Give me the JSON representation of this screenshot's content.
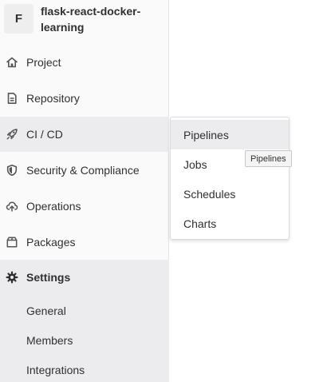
{
  "project": {
    "avatar_letter": "F",
    "name": "flask-react-docker-learning"
  },
  "sidebar": {
    "items": [
      {
        "label": "Project",
        "icon": "home-icon"
      },
      {
        "label": "Repository",
        "icon": "document-icon"
      },
      {
        "label": "CI / CD",
        "icon": "rocket-icon"
      },
      {
        "label": "Security & Compliance",
        "icon": "shield-icon"
      },
      {
        "label": "Operations",
        "icon": "cloud-upload-icon"
      },
      {
        "label": "Packages",
        "icon": "package-icon"
      },
      {
        "label": "Settings",
        "icon": "gear-icon"
      }
    ],
    "settings_subitems": [
      {
        "label": "General"
      },
      {
        "label": "Members"
      },
      {
        "label": "Integrations"
      }
    ]
  },
  "flyout": {
    "items": [
      {
        "label": "Pipelines"
      },
      {
        "label": "Jobs"
      },
      {
        "label": "Schedules"
      },
      {
        "label": "Charts"
      }
    ]
  },
  "tooltip": {
    "text": "Pipelines"
  },
  "colors": {
    "sidebar_bg": "#fafafa",
    "active_bg": "#ececef",
    "text": "#303030",
    "icon": "#555555"
  }
}
